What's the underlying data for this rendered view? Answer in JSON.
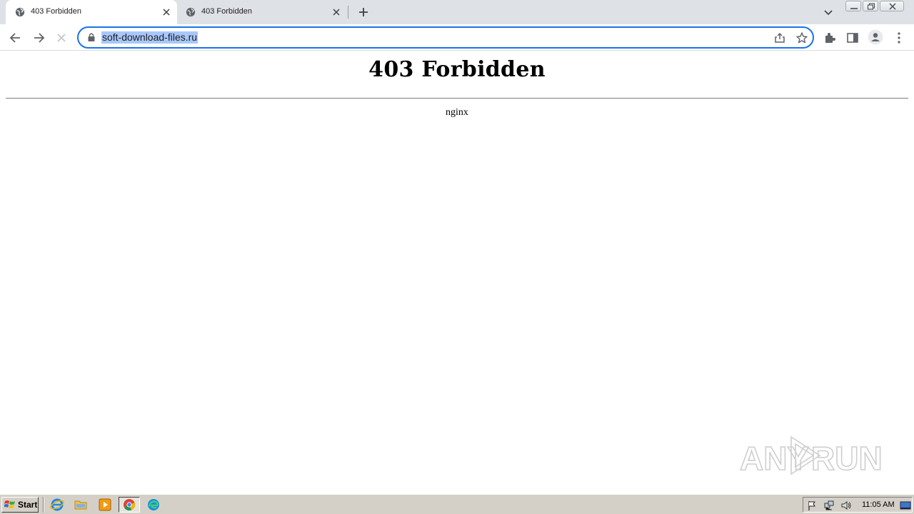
{
  "browser": {
    "tabs": [
      {
        "title": "403 Forbidden",
        "active": true
      },
      {
        "title": "403 Forbidden",
        "active": false
      }
    ],
    "address_bar": {
      "url": "soft-download-files.ru"
    }
  },
  "page": {
    "heading": "403 Forbidden",
    "server": "nginx"
  },
  "watermark": {
    "text_left": "ANY",
    "text_right": "RUN"
  },
  "taskbar": {
    "start_label": "Start",
    "clock": "11:05 AM"
  },
  "colors": {
    "accent": "#1a73e8",
    "url_selection": "#a8c7fa",
    "tabstrip_bg": "#dee1e6",
    "taskbar_bg": "#d4d0c8"
  }
}
